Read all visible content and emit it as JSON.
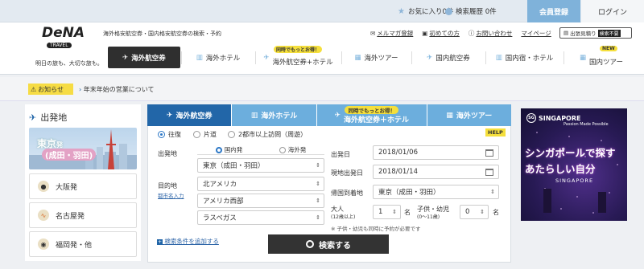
{
  "topbar": {
    "favorites": "お気に入り0件",
    "history": "検索履歴 0件",
    "register": "会員登録",
    "login": "ログイン"
  },
  "header": {
    "logo_text": "DeNA",
    "logo_sub": "TRAVEL",
    "tagline": "明日の旅も、大切な旅も。",
    "subtitle": "海外格安航空券・国内格安航空券の検索・予約",
    "links": [
      "メルマガ登録",
      "初めての方",
      "お問い合わせ",
      "マイページ"
    ],
    "business_trip": "出張見積り",
    "business_badge": "検索不要"
  },
  "nav": [
    {
      "label": "海外航空券",
      "badge": ""
    },
    {
      "label": "海外ホテル",
      "badge": ""
    },
    {
      "label": "海外航空券+ホテル",
      "badge": "同時でもっとお得！"
    },
    {
      "label": "海外ツアー",
      "badge": ""
    },
    {
      "label": "国内航空券",
      "badge": ""
    },
    {
      "label": "国内宿・ホテル",
      "badge": ""
    },
    {
      "label": "国内ツアー",
      "badge": "NEW"
    }
  ],
  "notice": {
    "tag": "お知らせ",
    "text": "年末年始の営業について"
  },
  "departure": {
    "title": "出発地",
    "tokyo": "東京",
    "tokyo_suffix": "発",
    "tokyo_sub": "(成田・羽田)",
    "cities": [
      "大阪発",
      "名古屋発",
      "福岡発・他"
    ]
  },
  "search_tabs": [
    {
      "label": "海外航空券",
      "badge": ""
    },
    {
      "label": "海外ホテル",
      "badge": ""
    },
    {
      "label": "海外航空券＋ホテル",
      "badge": "同時でもっとお得！"
    },
    {
      "label": "海外ツアー",
      "badge": ""
    }
  ],
  "form": {
    "trip_types": [
      "往復",
      "片道",
      "2都市以上訪問（周遊）"
    ],
    "help": "HELP",
    "origin_label": "出発地",
    "origin_segments": [
      "国内発",
      "海外発"
    ],
    "origin_value": "東京（成田・羽田）",
    "dest_label": "目的地",
    "dest_link": "都市名入力",
    "dest_values": [
      "北アメリカ",
      "アメリカ西部",
      "ラスベガス"
    ],
    "depart_label": "出発日",
    "depart_value": "2018/01/06",
    "local_depart_label": "現地出発日",
    "local_depart_value": "2018/01/14",
    "return_label": "帰国到着地",
    "return_value": "東京（成田・羽田）",
    "adult_label": "大人",
    "adult_sub": "(12歳以上)",
    "adult_value": "1",
    "child_label": "子供・幼児",
    "child_sub": "(0～11歳)",
    "child_value": "0",
    "unit": "名",
    "note": "※ 子供・幼児も同時に予約が必要です",
    "add_conditions": "検索条件を追加する",
    "search_button": "検索する"
  },
  "ad": {
    "brand": "SINGAPORE",
    "brand_sub": "Passion Made Possible",
    "line1": "シンガポールで探す",
    "line2": "あたらしい自分",
    "caption": "SINGAPORE"
  },
  "colors": {
    "accent": "#2266a8",
    "tab": "#6caedd",
    "yellow": "#f5df3c"
  }
}
